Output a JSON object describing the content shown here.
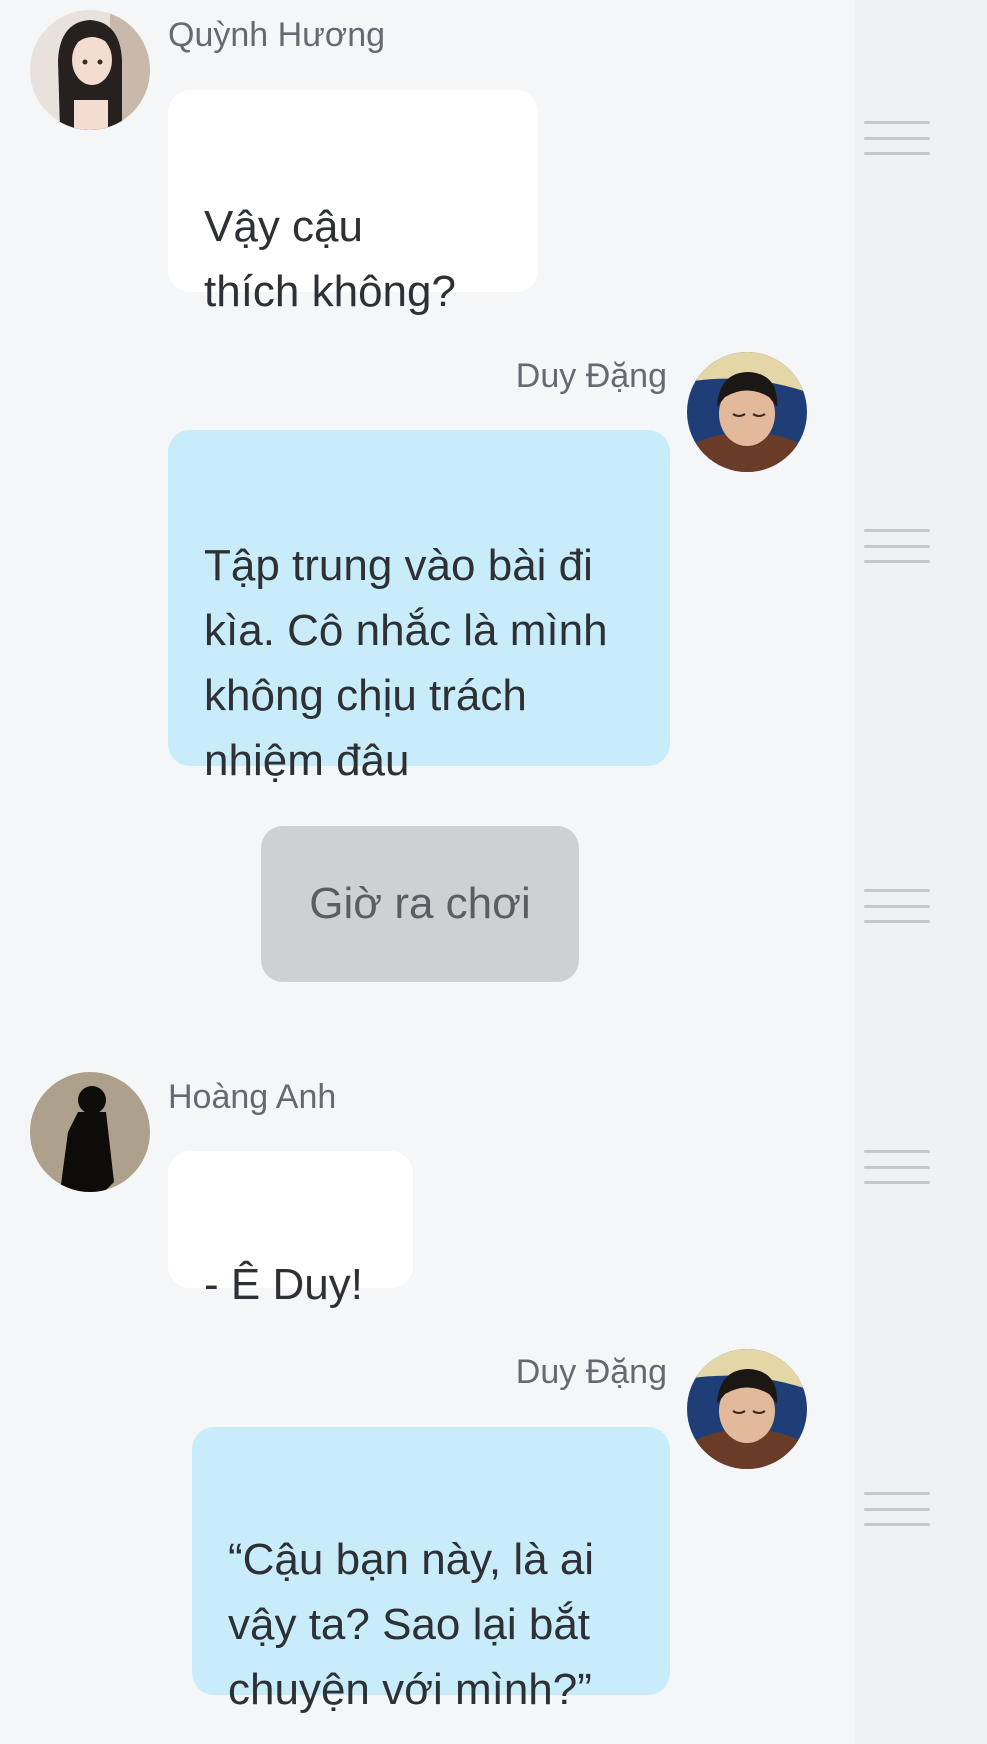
{
  "messages": [
    {
      "speaker": "Quỳnh Hương",
      "text": "Vậy cậu\nthích không?",
      "avatar": "girl-long-hair-avatar"
    },
    {
      "speaker": "Duy Đặng",
      "text": "Tập trung vào bài đi\nkìa. Cô nhắc là mình\nkhông chịu trách\nnhiệm đâu",
      "avatar": "boy-sleeping-avatar"
    },
    {
      "narration": "Giờ ra chơi"
    },
    {
      "speaker": "Hoàng Anh",
      "text": "- Ê Duy!",
      "avatar": "silhouette-avatar"
    },
    {
      "speaker": "Duy Đặng",
      "text": "“Cậu bạn này, là ai\nvậy ta? Sao lại bắt\nchuyện với mình?”",
      "avatar": "boy-sleeping-avatar"
    }
  ],
  "colors": {
    "background": "#f5f6f8",
    "rail": "#f0f1f3",
    "bubble_left": "#ffffff",
    "bubble_right": "#c9ecfb",
    "bubble_narration": "#cfd0d2"
  },
  "icons": {
    "drag_handle": "drag-handle-icon"
  }
}
